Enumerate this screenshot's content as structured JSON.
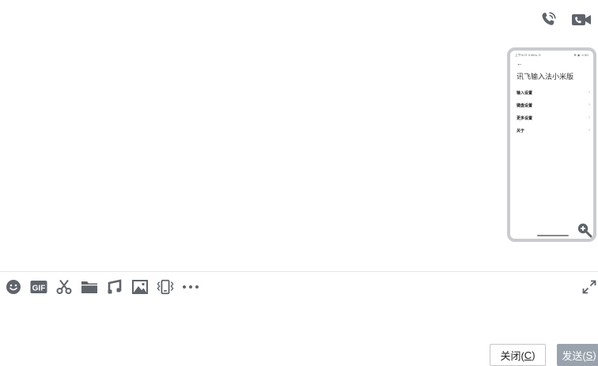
{
  "header": {
    "voice_call_icon": "phone-call-icon",
    "video_call_icon": "video-camera-icon"
  },
  "screenshot": {
    "status_left": "上午9:07 0.8K/s ⊙",
    "status_right": "✻ ◉ .ıl 5G",
    "back_arrow": "←",
    "title": "讯飞输入法小米版",
    "menu": [
      {
        "label": "输入设置",
        "chevron": "›"
      },
      {
        "label": "键盘设置",
        "chevron": "›"
      },
      {
        "label": "更多设置",
        "chevron": "›"
      },
      {
        "label": "关于",
        "chevron": "›"
      }
    ],
    "zoom_icon": "zoom-in-icon"
  },
  "toolbar": {
    "items": [
      "emoji-icon",
      "gif-icon",
      "scissors-icon",
      "folder-icon",
      "music-icon",
      "image-icon",
      "shake-icon",
      "more-icon"
    ],
    "gif_label": "GIF",
    "expand_icon": "expand-icon"
  },
  "buttons": {
    "close_label": "关闭(",
    "close_key": "C",
    "close_end": ")",
    "send_label": "发送(",
    "send_key": "S",
    "send_end": ")"
  },
  "colors": {
    "icon": "#5f646b",
    "send_bg": "#9aa3ad",
    "divider": "#e6e6e6"
  }
}
